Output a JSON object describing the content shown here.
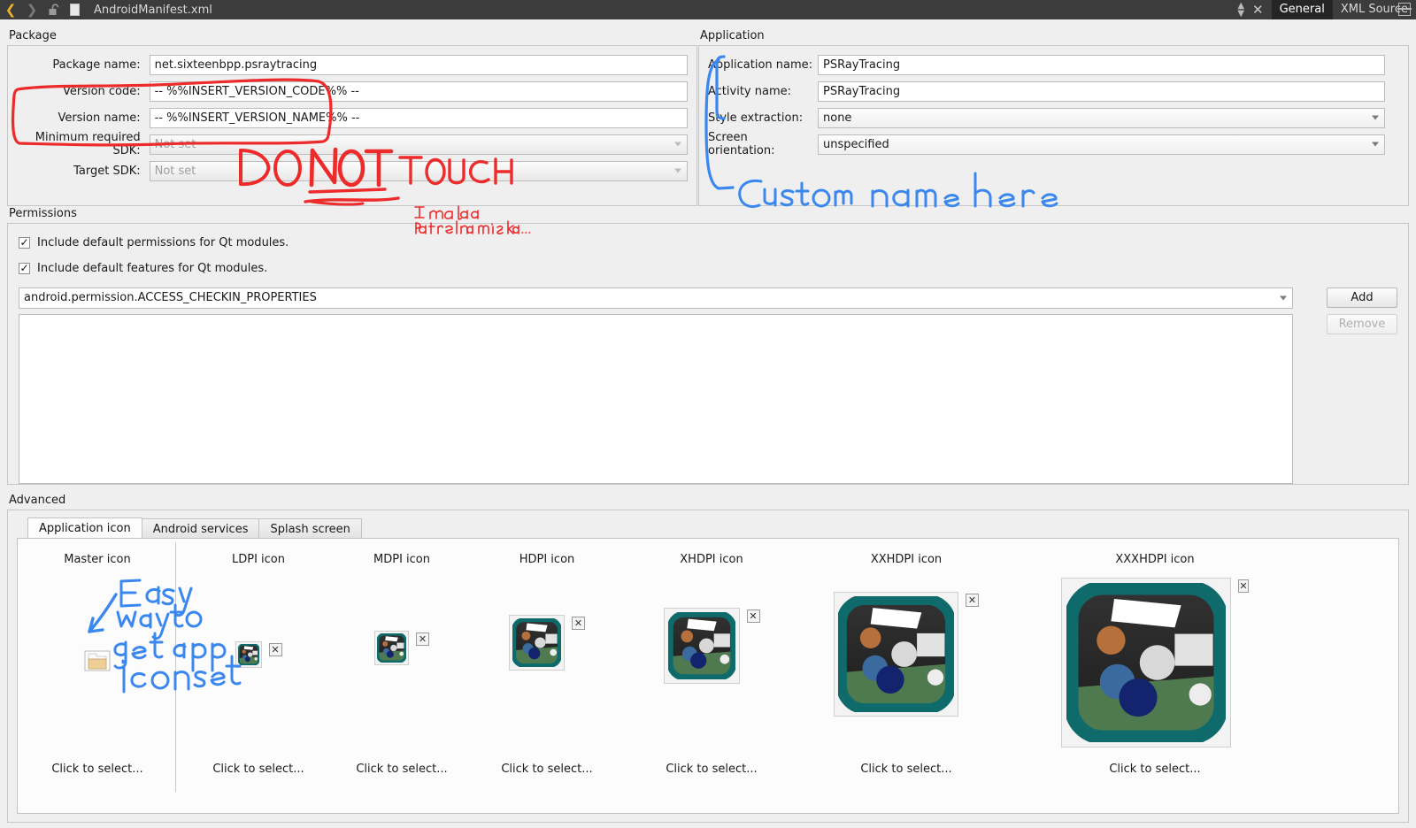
{
  "toolbar": {
    "back_icon": "chevron-left-icon",
    "forward_icon": "chevron-right-icon",
    "lock_icon": "unlocked-padlock-icon",
    "file_icon": "file-icon",
    "document_title": "AndroidManifest.xml",
    "stepper_icon": "up-down-stepper-icon",
    "close_icon": "close-icon",
    "tabs": [
      {
        "label": "General",
        "active": true
      },
      {
        "label": "XML Source",
        "active": false
      }
    ],
    "split_icon": "split-view-icon"
  },
  "package": {
    "group_title": "Package",
    "fields": [
      {
        "label": "Package name:",
        "value": "net.sixteenbpp.psraytracing",
        "type": "text"
      },
      {
        "label": "Version code:",
        "value": "-- %%INSERT_VERSION_CODE%% --",
        "type": "text"
      },
      {
        "label": "Version name:",
        "value": "-- %%INSERT_VERSION_NAME%% --",
        "type": "text"
      },
      {
        "label": "Minimum required SDK:",
        "value": "Not set",
        "type": "combo",
        "disabled": true
      },
      {
        "label": "Target SDK:",
        "value": "Not set",
        "type": "combo",
        "disabled": true
      }
    ]
  },
  "application": {
    "group_title": "Application",
    "fields": [
      {
        "label": "Application name:",
        "value": "PSRayTracing",
        "type": "text"
      },
      {
        "label": "Activity name:",
        "value": "PSRayTracing",
        "type": "text"
      },
      {
        "label": "Style extraction:",
        "value": "none",
        "type": "combo",
        "disabled": false
      },
      {
        "label": "Screen orientation:",
        "value": "unspecified",
        "type": "combo",
        "disabled": false
      }
    ]
  },
  "permissions": {
    "group_title": "Permissions",
    "checkbox_default_permissions": "Include default permissions for Qt modules.",
    "checkbox_default_features": "Include default features for Qt modules.",
    "checkbox_permissions_checked": true,
    "checkbox_features_checked": true,
    "check_glyph": "✓",
    "selected_permission": "android.permission.ACCESS_CHECKIN_PROPERTIES",
    "add_label": "Add",
    "remove_label": "Remove",
    "remove_disabled": true,
    "list_items": []
  },
  "advanced": {
    "group_title": "Advanced",
    "tabs": [
      {
        "label": "Application icon",
        "active": true
      },
      {
        "label": "Android services",
        "active": false
      },
      {
        "label": "Splash screen",
        "active": false
      }
    ],
    "click_to_select": "Click to select...",
    "clear_icon": "clear-x-icon",
    "folder_icon": "folder-icon",
    "icons": [
      {
        "caption": "Master icon",
        "size": 0,
        "has_image": false,
        "has_clear": false,
        "click": "Click to select..."
      },
      {
        "caption": "LDPI icon",
        "size": 27,
        "has_image": true,
        "has_clear": true,
        "click": "Click to select..."
      },
      {
        "caption": "MDPI icon",
        "size": 36,
        "has_image": true,
        "has_clear": true,
        "click": "Click to select..."
      },
      {
        "caption": "HDPI icon",
        "size": 54,
        "has_image": true,
        "has_clear": true,
        "click": "Click to select..."
      },
      {
        "caption": "XHDPI icon",
        "size": 72,
        "has_image": true,
        "has_clear": true,
        "click": "Click to select..."
      },
      {
        "caption": "XXHDPI icon",
        "size": 108,
        "has_image": true,
        "has_clear": true,
        "click": "Click to select..."
      },
      {
        "caption": "XXXHDPI icon",
        "size": 144,
        "has_image": true,
        "has_clear": true,
        "click": "Click to select..."
      }
    ]
  },
  "annotations": {
    "red_color": "#ee2b2b",
    "blue_color": "#3b87f0",
    "do_not_touch": "DO NOT TOUCH",
    "terrible_mistake_line1": "I made a",
    "terrible_mistake_line2": "terrible mistake...",
    "custom_name_here": "Custom name here",
    "easy_way_line1": "Easy",
    "easy_way_line2": "way to",
    "easy_way_line3": "get app",
    "easy_way_line4": "icon set"
  }
}
